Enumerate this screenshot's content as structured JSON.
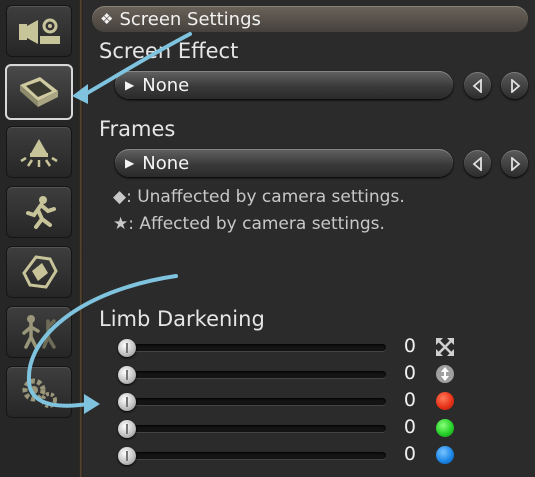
{
  "header": {
    "title": "Screen Settings",
    "marker": "❖"
  },
  "screen_effect": {
    "label": "Screen Effect",
    "value": "None"
  },
  "frames": {
    "label": "Frames",
    "value": "None"
  },
  "notes": [
    {
      "symbol": "◆",
      "text": ": Unaffected by camera settings."
    },
    {
      "symbol": "★",
      "text": ": Affected by camera settings."
    }
  ],
  "limb_darkening": {
    "label": "Limb Darkening",
    "sliders": [
      {
        "name": "size",
        "value": "0",
        "icon": "expand-arrows-icon"
      },
      {
        "name": "vertical",
        "value": "0",
        "icon": "vertical-adjust-icon"
      },
      {
        "name": "red",
        "value": "0",
        "color": "#e8341a"
      },
      {
        "name": "green",
        "value": "0",
        "color": "#27d22a"
      },
      {
        "name": "blue",
        "value": "0",
        "color": "#1e88e8"
      }
    ]
  },
  "rail": {
    "items": [
      {
        "icon": "camera-settings-icon"
      },
      {
        "icon": "screen-settings-icon",
        "active": true
      },
      {
        "icon": "lighting-icon"
      },
      {
        "icon": "running-figure-icon"
      },
      {
        "icon": "effects-icon"
      },
      {
        "icon": "character-pose-icon"
      },
      {
        "icon": "gear-settings-icon"
      }
    ]
  }
}
